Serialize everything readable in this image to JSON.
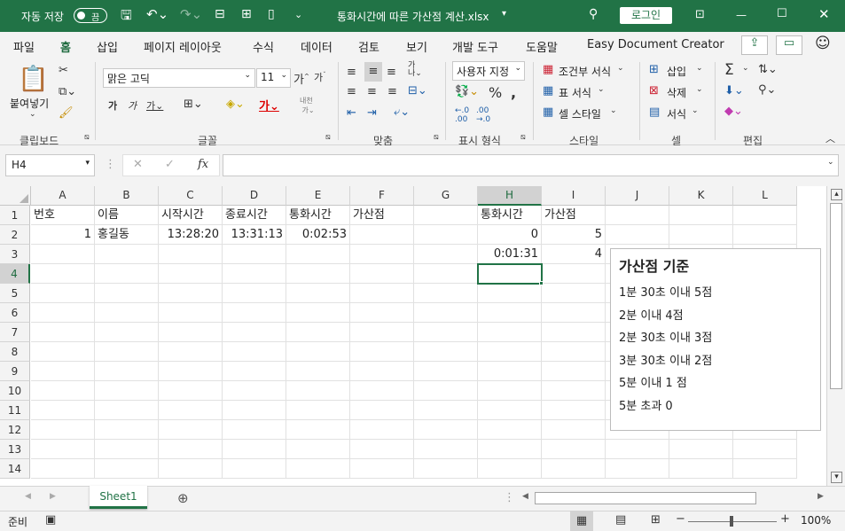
{
  "titlebar": {
    "autosave": "자동 저장",
    "toggle_state": "끔",
    "filename": "통화시간에 따른 가산점 계산.xlsx",
    "login": "로그인"
  },
  "menu": [
    "파일",
    "홈",
    "삽입",
    "페이지 레이아웃",
    "수식",
    "데이터",
    "검토",
    "보기",
    "개발 도구",
    "도움말",
    "Easy Document Creator"
  ],
  "ribbon": {
    "paste": "붙여넣기",
    "font_name": "맑은 고딕",
    "font_size": "11",
    "number_format": "사용자 지정",
    "cond_format": "조건부 서식",
    "table_format": "표 서식",
    "cell_style": "셀 스타일",
    "insert": "삽입",
    "delete": "삭제",
    "format": "서식",
    "wrap": "자동 줄바꿈",
    "groups": {
      "clipboard": "클립보드",
      "font": "글꼴",
      "align": "맞춤",
      "number": "표시 형식",
      "style": "스타일",
      "cells": "셀",
      "edit": "편집"
    }
  },
  "formula_bar": {
    "namebox": "H4",
    "fx": "fx",
    "value": ""
  },
  "columns": [
    "A",
    "B",
    "C",
    "D",
    "E",
    "F",
    "G",
    "H",
    "I",
    "J",
    "K",
    "L"
  ],
  "rows": [
    "1",
    "2",
    "3",
    "4",
    "5",
    "6",
    "7",
    "8",
    "9",
    "10",
    "11",
    "12",
    "13",
    "14"
  ],
  "cells": {
    "A1": "번호",
    "B1": "이름",
    "C1": "시작시간",
    "D1": "종료시간",
    "E1": "통화시간",
    "F1": "가산점",
    "H1": "통화시간",
    "I1": "가산점",
    "A2": "1",
    "B2": "홍길동",
    "C2": "13:28:20",
    "D2": "13:31:13",
    "E2": "0:02:53",
    "H2": "0",
    "I2": "5",
    "H3": "0:01:31",
    "I3": "4"
  },
  "textbox": {
    "title": "가산점 기준",
    "lines": [
      "1분 30초 이내 5점",
      "2분 이내 4점",
      "2분 30초 이내 3점",
      "3분 30초 이내 2점",
      "5분 이내 1 점",
      "5분 초과 0"
    ]
  },
  "sheet_tab": "Sheet1",
  "status": {
    "ready": "준비",
    "zoom": "100%"
  }
}
